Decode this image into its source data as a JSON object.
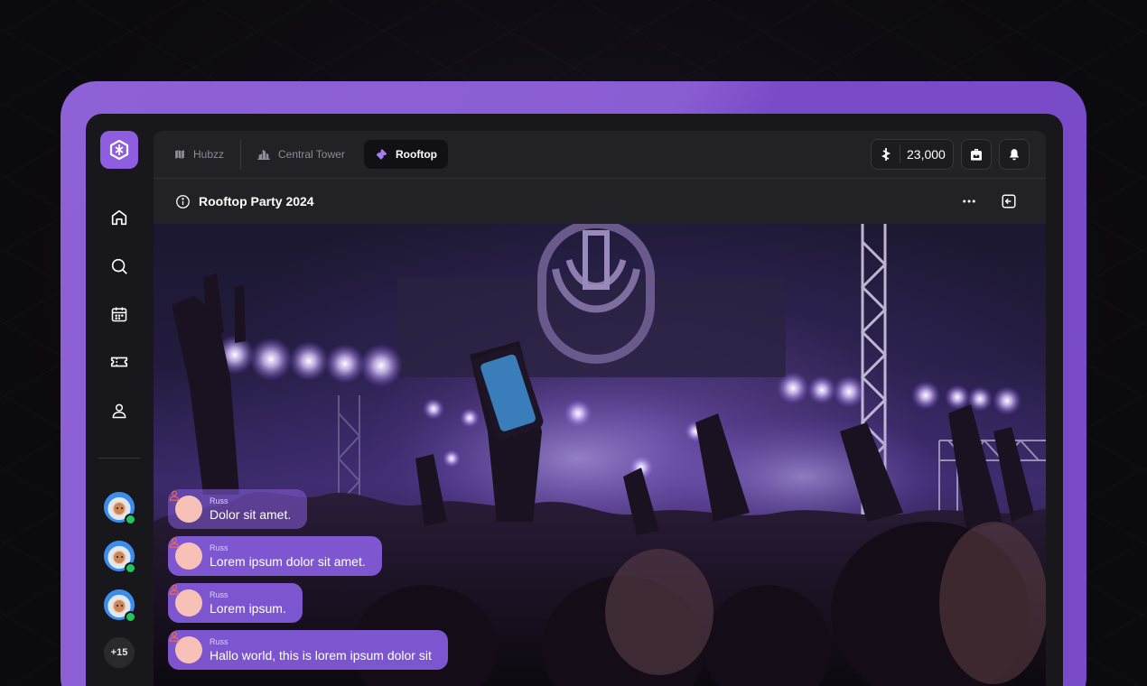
{
  "app": {
    "accent_color": "#8e5de0",
    "frame_color": "#8a5ed3",
    "background_color": "#0d0b10"
  },
  "sidebar": {
    "logo_icon": "hubzz-logo-icon",
    "nav_items": [
      {
        "icon": "home-icon"
      },
      {
        "icon": "search-icon"
      },
      {
        "icon": "calendar-icon"
      },
      {
        "icon": "ticket-icon"
      },
      {
        "icon": "user-icon"
      }
    ],
    "online_users": [
      {
        "avatar": "astronaut-avatar",
        "status": "online"
      },
      {
        "avatar": "astronaut-avatar",
        "status": "online"
      },
      {
        "avatar": "astronaut-avatar",
        "status": "online"
      }
    ],
    "more_users_label": "+15"
  },
  "topbar": {
    "breadcrumbs": [
      {
        "label": "Hubzz",
        "icon": "map-icon",
        "active": false
      },
      {
        "label": "Central Tower",
        "icon": "building-icon",
        "active": false
      },
      {
        "label": "Rooftop",
        "icon": "ticket-icon",
        "active": true
      }
    ],
    "balance_icon": "hubzz-coin-icon",
    "balance": "23,000",
    "backpack_icon": "backpack-icon",
    "notification_icon": "bell-icon"
  },
  "event": {
    "info_icon": "info-icon",
    "title": "Rooftop Party 2024",
    "more_icon": "more-horizontal-icon",
    "exit_icon": "exit-icon"
  },
  "chat": {
    "messages": [
      {
        "author": "Russ",
        "text": "Dolor sit amet."
      },
      {
        "author": "Russ",
        "text": "Lorem ipsum dolor sit amet."
      },
      {
        "author": "Russ",
        "text": "Lorem ipsum."
      },
      {
        "author": "Russ",
        "text": "Hallo world, this is lorem ipsum dolor sit"
      }
    ]
  }
}
